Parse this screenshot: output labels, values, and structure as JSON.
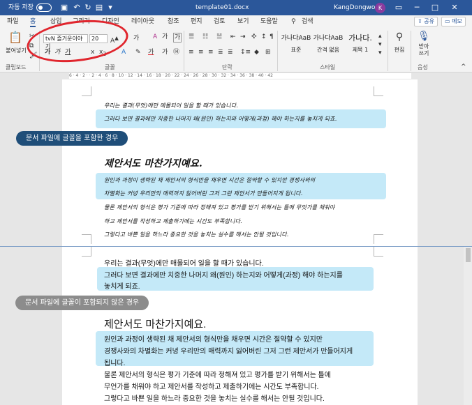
{
  "titlebar": {
    "autosave_label": "자동 저장",
    "autosave_state": "끔",
    "filename": "template01.docx",
    "user": "KangDongwoo",
    "avatar_initial": "K"
  },
  "tabs": [
    "파일",
    "홈",
    "삽입",
    "그리기",
    "디자인",
    "레이아웃",
    "참조",
    "편지",
    "검토",
    "보기",
    "도움말",
    "검색"
  ],
  "active_tab": "홈",
  "tab_buttons": {
    "share": "공유",
    "comments": "메모"
  },
  "ribbon": {
    "paste_label": "붙여넣기",
    "clipboard_label": "클립보드",
    "font_name": "tvN 즐거운이야기",
    "font_size": "20",
    "font_group_label": "글꼴",
    "paragraph_group_label": "단락",
    "style_group_label": "스타일",
    "styles": [
      {
        "sample": "가나다AaB",
        "name": "표준"
      },
      {
        "sample": "가나다AaB",
        "name": "간격 없음"
      },
      {
        "sample": "가나다.",
        "name": "제목 1"
      }
    ],
    "edit_label": "편집",
    "dictate_label": "받아\n쓰기",
    "voice_label": "음성"
  },
  "ruler_marks": "6 · 4 · 2 · · 2 · 4 · 6 · 8 · 10 · 12 · 14 · 16 · 18 · 20 · 22 · 24 · 26 · 28 · 30 · 32 · 34 · 36 · 38 · 40 · 42",
  "top_doc": {
    "lines_before": [
      "우리는 결과(무엇)에만 매몰되어 일을 할 때가 있습니다.",
      "그러다 보면 결과에만 치중한 나머지 왜(원인) 하는지와 어떻게(과정) 해야 하는지를 놓치게 되죠."
    ],
    "pill": "문서 파일에 글꼴을 포함한 경우",
    "heading": "제안서도 마찬가지예요.",
    "body": [
      "원인과 과정이 생략된 채 제안서의 형식만을 채우면 시간은 절약할 수 있지만 경쟁사와의",
      "차별화는 커녕 우리만의 매력까지 잃어버린 그저 그런 제안서가 만들어지게 됩니다.",
      "물론 제안서의 형식은 평가 기준에 따라 정해져 있고 평가를 받기 위해서는 틀에 무엇가를 채워야",
      "하고 제안서를 작성하고 제출하기에는 시간도 부족합니다.",
      "그렇다고 바쁜 일을 하느라 중요한 것을 놓치는 실수를 해서는 안될 것입니다."
    ]
  },
  "bottom_doc": {
    "lines_before": [
      "우리는 결과(무엇)에만 매몰되어 일을 할 때가 있습니다.",
      "그러다 보면 결과에만 치중한 나머지 왜(원인) 하는지와 어떻게(과정) 해야 하는지를",
      "놓치게 되죠."
    ],
    "pill": "문서 파일에 글꼴이 포함되지 않은 경우",
    "heading": "제안서도 마찬가지예요.",
    "body": [
      "원인과 과정이 생략된 채 제안서의 형식만을 채우면 시간은 절약할 수 있지만",
      "경쟁사와의 차별화는 커녕 우리만의 매력까지 잃어버린 그저 그런 제안서가 만들어지게",
      "됩니다.",
      "물론 제안서의 형식은 평가 기준에 따라 정해져 있고 평가를 받기 위해서는 틀에",
      "무언가를 채워야 하고 제안서를 작성하고 제출하기에는 시간도 부족합니다.",
      "그렇다고 바쁜 일을 하느라 중요한 것을 놓치는 실수를 해서는 안될 것입니다."
    ]
  },
  "colors": {
    "title_bar": "#2b579a",
    "highlight": "#c4e9f8",
    "pill_top": "#1f4e79",
    "pill_bottom": "#8c8c8c",
    "annotation_oval": "#e0252d"
  }
}
